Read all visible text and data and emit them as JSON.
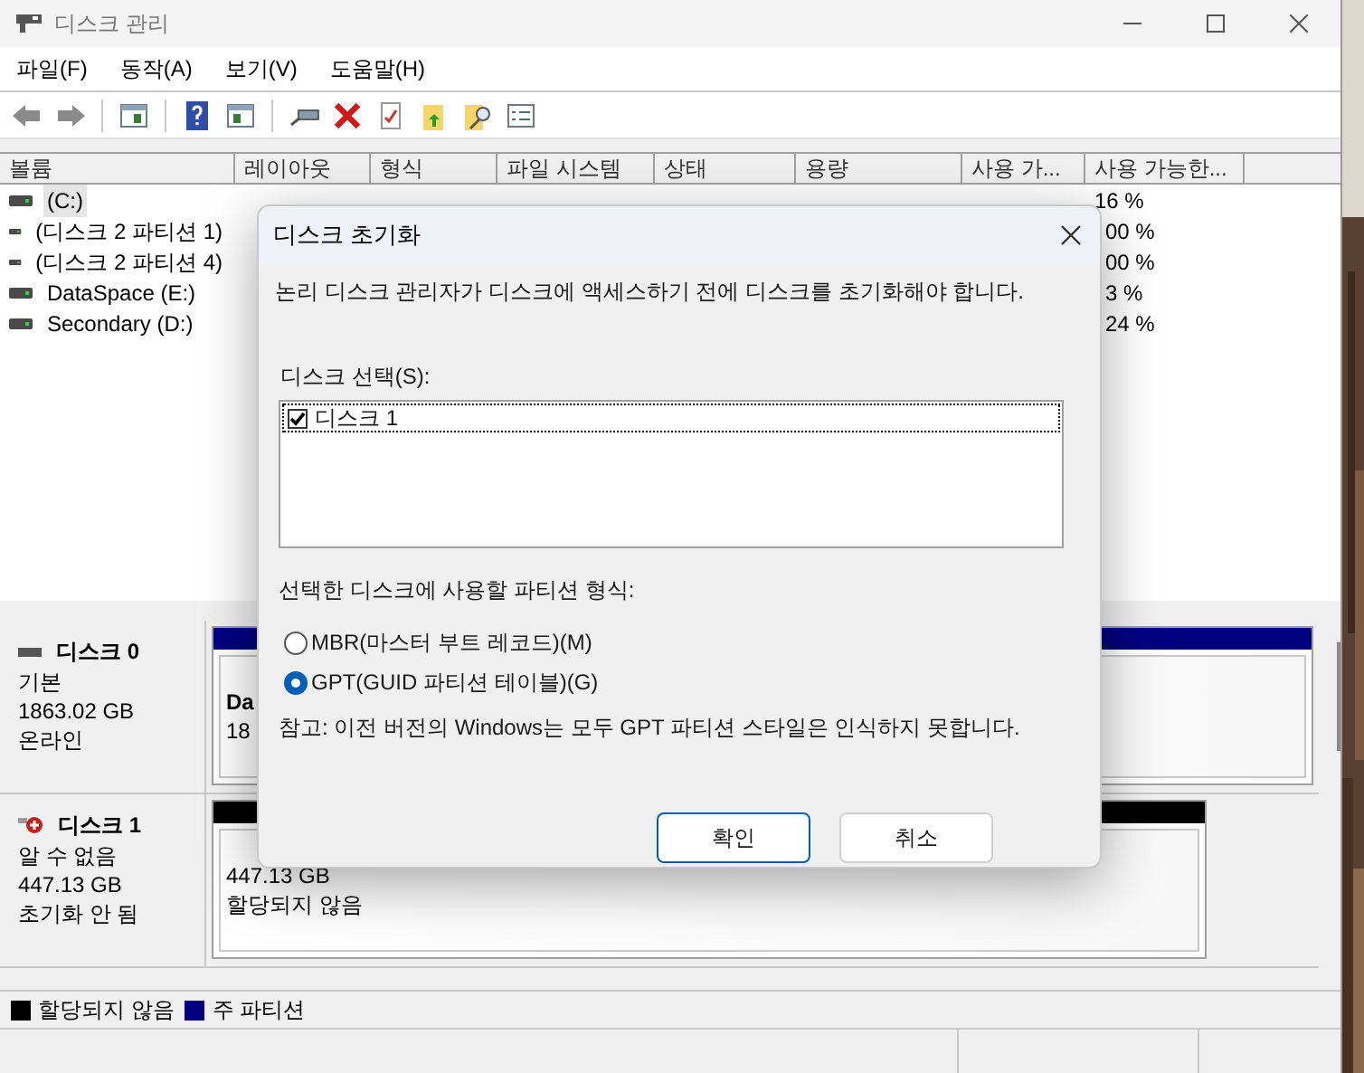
{
  "window": {
    "title": "디스크 관리"
  },
  "menu": [
    {
      "label": "파일(F)"
    },
    {
      "label": "동작(A)"
    },
    {
      "label": "보기(V)"
    },
    {
      "label": "도움말(H)"
    }
  ],
  "table": {
    "columns": [
      "볼륨",
      "레이아웃",
      "형식",
      "파일 시스템",
      "상태",
      "용량",
      "사용 가...",
      "사용 가능한..."
    ],
    "rows": [
      {
        "volume": "(C:)",
        "free_percent": "16 %",
        "selected": true
      },
      {
        "volume": "(디스크 2 파티션 1)",
        "free_percent": "00 %",
        "selected": false
      },
      {
        "volume": "(디스크 2 파티션 4)",
        "free_percent": "00 %",
        "selected": false
      },
      {
        "volume": "DataSpace (E:)",
        "free_percent": "3 %",
        "selected": false
      },
      {
        "volume": "Secondary (D:)",
        "free_percent": "24 %",
        "selected": false
      }
    ]
  },
  "disks": [
    {
      "name": "디스크 0",
      "kind": "online",
      "lines": [
        "기본",
        "1863.02 GB",
        "온라인"
      ],
      "partition": {
        "color": "#000080",
        "lines": [
          "Da",
          "18"
        ]
      }
    },
    {
      "name": "디스크 1",
      "kind": "error",
      "lines": [
        "알 수 없음",
        "447.13 GB",
        "초기화 안 됨"
      ],
      "partition": {
        "color": "#000000",
        "lines": [
          "447.13 GB",
          "할당되지 않음"
        ]
      }
    }
  ],
  "legend": [
    {
      "label": "할당되지 않음",
      "color": "#000000"
    },
    {
      "label": "주 파티션",
      "color": "#000080"
    }
  ],
  "dialog": {
    "title": "디스크 초기화",
    "message": "논리 디스크 관리자가 디스크에 액세스하기 전에 디스크를 초기화해야 합니다.",
    "list_label": "디스크 선택(S):",
    "disks": [
      {
        "label": "디스크 1",
        "checked": true,
        "selected": true
      }
    ],
    "format_label": "선택한 디스크에 사용할 파티션 형식:",
    "options": [
      {
        "label": "MBR(마스터 부트 레코드)(M)",
        "selected": false
      },
      {
        "label": "GPT(GUID 파티션 테이블)(G)",
        "selected": true
      }
    ],
    "note": "참고: 이전 버전의 Windows는 모두 GPT 파티션 스타일은 인식하지 못합니다.",
    "buttons": [
      {
        "label": "확인",
        "default": true
      },
      {
        "label": "취소",
        "default": false
      }
    ]
  }
}
